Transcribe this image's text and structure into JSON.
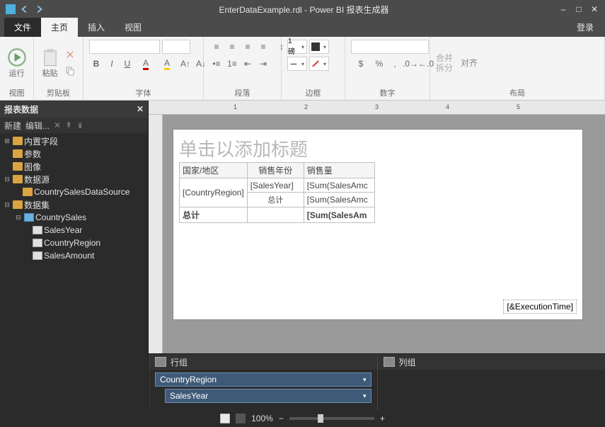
{
  "title": "EnterDataExample.rdl - Power BI 报表生成器",
  "tabs": {
    "file": "文件",
    "home": "主页",
    "insert": "插入",
    "view": "视图",
    "login": "登录"
  },
  "ribbon": {
    "run": "运行",
    "paste": "粘贴",
    "groups": {
      "view": "视图",
      "clipboard": "剪贴板",
      "font": "字体",
      "paragraph": "段落",
      "border": "边框",
      "number": "数字",
      "layout": "布局"
    },
    "layout": {
      "merge": "合并",
      "split": "拆分",
      "align": "对齐"
    },
    "border_weight": "1 磅"
  },
  "panel": {
    "title": "报表数据",
    "new": "新建",
    "edit": "编辑...",
    "x_icon": "✕",
    "up": "↟",
    "dn": "↡"
  },
  "tree": {
    "builtin": "内置字段",
    "params": "参数",
    "images": "图像",
    "datasources": "数据源",
    "ds1": "CountrySalesDataSource",
    "datasets": "数据集",
    "dset1": "CountrySales",
    "f1": "SalesYear",
    "f2": "CountryRegion",
    "f3": "SalesAmount"
  },
  "canvas": {
    "title_placeholder": "单击以添加标题",
    "hdr1": "国家/地区",
    "hdr2": "销售年份",
    "hdr3": "销售量",
    "c1": "[CountryRegion]",
    "c2": "[SalesYear]",
    "c3": "[Sum(SalesAmc",
    "subtotal": "总计",
    "c3b": "[Sum(SalesAmc",
    "grand": "总计",
    "c3c": "[Sum(SalesAm",
    "exec": "[&ExecutionTime]"
  },
  "ruler_ticks": [
    "1",
    "2",
    "3",
    "4",
    "5"
  ],
  "groups": {
    "row": "行组",
    "col": "列组",
    "g1": "CountryRegion",
    "g2": "SalesYear"
  },
  "status": {
    "zoom": "100%",
    "minus": "−",
    "plus": "+"
  }
}
